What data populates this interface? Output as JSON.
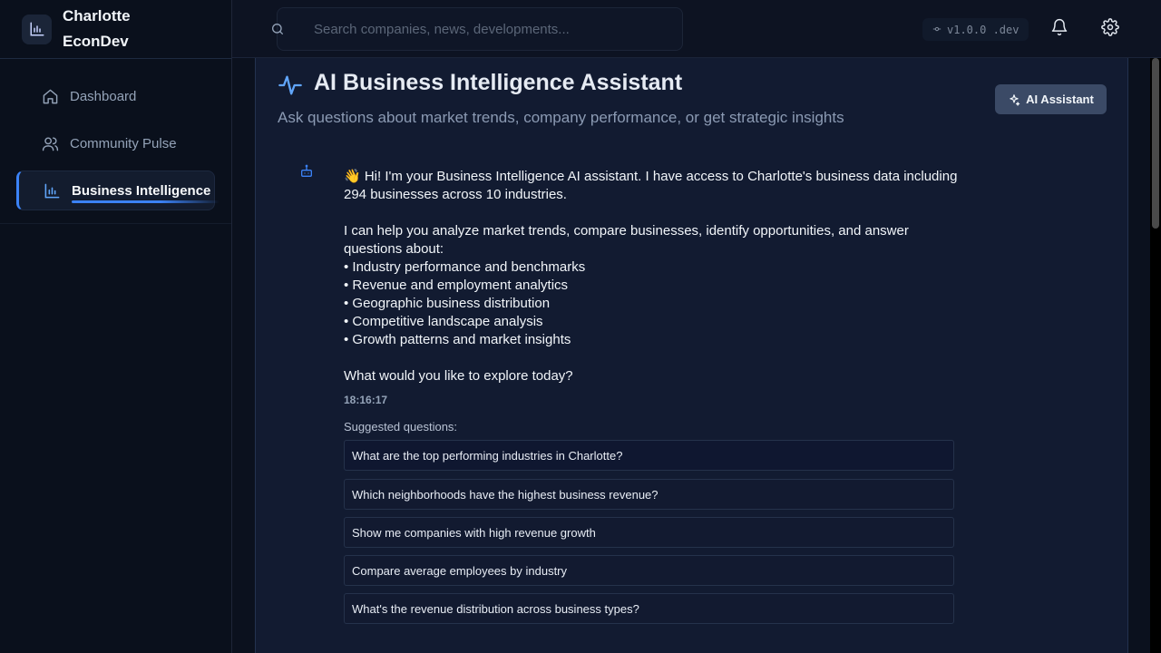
{
  "brand": {
    "title": "Charlotte EconDev",
    "icon": "bar-chart-icon"
  },
  "sidebar": {
    "items": [
      {
        "label": "Dashboard",
        "icon": "home-icon",
        "active": false
      },
      {
        "label": "Community Pulse",
        "icon": "users-icon",
        "active": false
      },
      {
        "label": "Business Intelligence",
        "icon": "bar-chart-icon",
        "active": true
      }
    ]
  },
  "topbar": {
    "search_placeholder": "Search companies, news, developments...",
    "version": "v1.0.0 .dev"
  },
  "panel": {
    "title": "AI Business Intelligence Assistant",
    "subtitle": "Ask questions about market trends, company performance, or get strategic insights",
    "ai_button": "AI Assistant"
  },
  "chat": {
    "intro": "👋 Hi! I'm your Business Intelligence AI assistant. I have access to Charlotte's business data including 294 businesses across 10 industries.",
    "help_intro": "I can help you analyze market trends, compare businesses, identify opportunities, and answer questions about:",
    "bullets": [
      "• Industry performance and benchmarks",
      "• Revenue and employment analytics",
      "• Geographic business distribution",
      "• Competitive landscape analysis",
      "• Growth patterns and market insights"
    ],
    "closing": "What would you like to explore today?",
    "timestamp": "18:16:17",
    "suggested_label": "Suggested questions:",
    "suggestions": [
      "What are the top performing industries in Charlotte?",
      "Which neighborhoods have the highest business revenue?",
      "Show me companies with high revenue growth",
      "Compare average employees by industry",
      "What's the revenue distribution across business types?"
    ]
  },
  "colors": {
    "accent": "#3b82f6",
    "background": "#0b111e",
    "panel": "#121b31"
  }
}
